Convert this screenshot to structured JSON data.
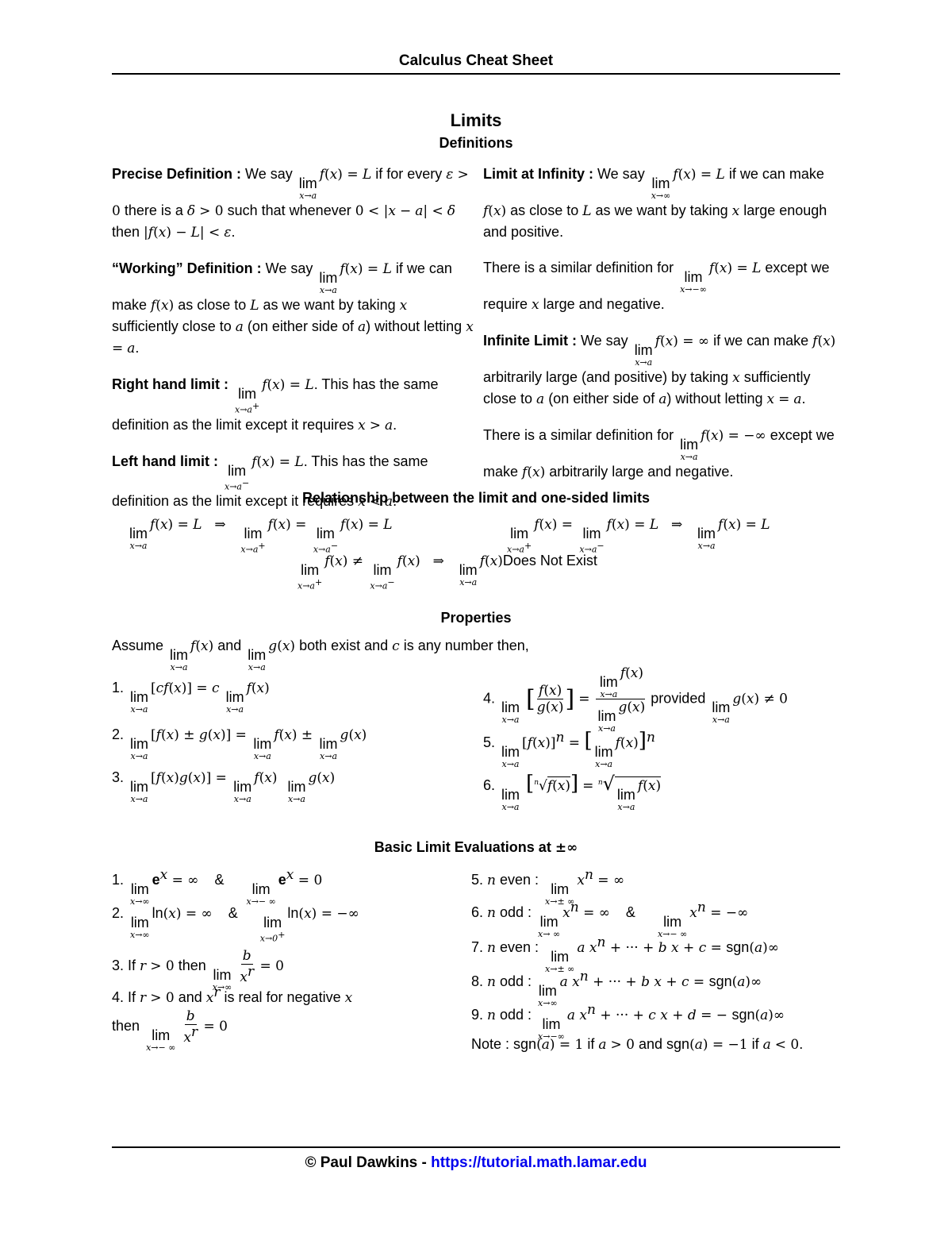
{
  "header": {
    "title": "Calculus Cheat Sheet"
  },
  "section": {
    "title": "Limits",
    "subtitle": "Definitions"
  },
  "definitions": {
    "left": [
      {
        "label": "Precise Definition :",
        "text": "We say lim x→a f(x) = L if for every ε > 0 there is a δ > 0 such that whenever 0 < |x − a| < δ then |f(x) − L| < ε."
      },
      {
        "label": "“Working” Definition :",
        "text": "We say lim x→a f(x) = L if we can make f(x) as close to L as we want by taking x sufficiently close to a (on either side of a) without letting x = a."
      },
      {
        "label": "Right hand limit :",
        "text": "lim x→a+ f(x) = L. This has the same definition as the limit except it requires x > a."
      },
      {
        "label": "Left hand limit :",
        "text": "lim x→a− f(x) = L. This has the same definition as the limit except it requires x < a."
      }
    ],
    "right": [
      {
        "label": "Limit at Infinity :",
        "text": "We say lim x→∞ f(x) = L if we can make f(x) as close to L as we want by taking x large enough and positive."
      },
      {
        "label": "",
        "text": "There is a similar definition for lim x→−∞ f(x) = L except we require x large and negative."
      },
      {
        "label": "Infinite Limit :",
        "text": "We say lim x→a f(x) = ∞ if we can make f(x) arbitrarily large (and positive) by taking x sufficiently close to a (on either side of a) without letting x = a."
      },
      {
        "label": "",
        "text": "There is a similar definition for lim x→a f(x) = −∞ except we make f(x) arbitrarily large and negative."
      }
    ]
  },
  "relationship": {
    "title": "Relationship between the limit and one-sided limits",
    "formulas": [
      "lim x→a f(x) = L ⇒ lim x→a+ f(x) = lim x→a− f(x) = L",
      "lim x→a+ f(x) = lim x→a− f(x) = L ⇒ lim x→a f(x) = L",
      "lim x→a+ f(x) ≠ lim x→a− f(x) ⇒ lim x→a f(x) Does Not Exist"
    ],
    "dne": "Does Not Exist"
  },
  "properties": {
    "title": "Properties",
    "intro": {
      "a": "Assume",
      "b": "and",
      "c": "both exist and",
      "d": "is any number then,"
    },
    "items": [
      "1. lim x→a [c f(x)] = c lim x→a f(x)",
      "2. lim x→a [f(x) ± g(x)] = lim x→a f(x) ± lim x→a g(x)",
      "3. lim x→a [f(x) g(x)] = lim x→a f(x) lim x→a g(x)",
      "4. lim x→a [f(x)/g(x)] = lim x→a f(x) / lim x→a g(x) provided lim x→a g(x) ≠ 0",
      "5. lim x→a [f(x)]^n = [lim x→a f(x)]^n",
      "6. lim x→a [ⁿ√f(x)] = ⁿ√(lim x→a f(x))"
    ],
    "provided": "provided"
  },
  "basic": {
    "title": "Basic Limit Evaluations at",
    "title_symbol": "±∞",
    "left": [
      "1. lim x→∞ e^x = ∞ & lim x→−∞ e^x = 0",
      "2. lim x→∞ ln(x) = ∞ & lim x→0+ ln(x) = −∞",
      "3. If r > 0 then lim x→∞ b/x^r = 0",
      "4. If r > 0 and x^r is real for negative x then lim x→−∞ b/x^r = 0"
    ],
    "right": [
      "5. n even : lim x→±∞ x^n = ∞",
      "6. n odd : lim x→∞ x^n = ∞ & lim x→−∞ x^n = −∞",
      "7. n even : lim x→±∞ a x^n + ··· + b x + c = sgn(a)∞",
      "8. n odd : lim x→∞ a x^n + ··· + b x + c = sgn(a)∞",
      "9. n odd : lim x→−∞ a x^n + ··· + c x + d = −sgn(a)∞",
      "Note : sgn(a) = 1 if a > 0 and sgn(a) = −1 if a < 0."
    ],
    "words": {
      "even": "even :",
      "odd": "odd :",
      "if": "If",
      "then": "then",
      "and": "and",
      "is_real": "is real for negative",
      "note": "Note :",
      "sgn": "sgn",
      "amp": "&",
      "ln": "ln",
      "e": "e"
    }
  },
  "footer": {
    "copyright": "© Paul Dawkins - ",
    "link": "https://tutorial.math.lamar.edu"
  },
  "colors": {
    "link": "#0000ee",
    "text": "#000000"
  },
  "lim": "lim"
}
